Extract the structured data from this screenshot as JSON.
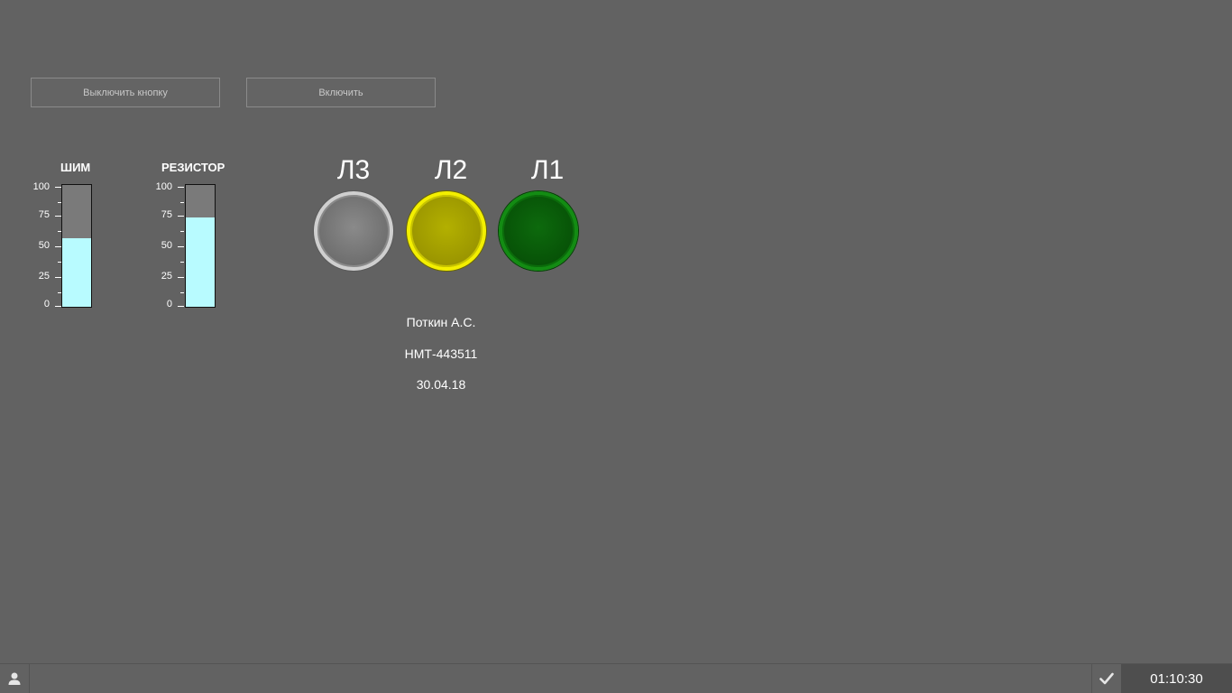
{
  "buttons": {
    "disable_label": "Выключить кнопку",
    "enable_label": "Включить"
  },
  "gauges": [
    {
      "title": "ШИМ",
      "value_percent": 56,
      "ticks": [
        "100",
        "75",
        "50",
        "25",
        "0"
      ]
    },
    {
      "title": "РЕЗИСТОР",
      "value_percent": 73,
      "ticks": [
        "100",
        "75",
        "50",
        "25",
        "0"
      ]
    }
  ],
  "lamps": [
    {
      "label": "Л3",
      "state": "off",
      "color": "#8a8a8a"
    },
    {
      "label": "Л2",
      "state": "on",
      "color": "#f3ef00"
    },
    {
      "label": "Л1",
      "state": "off",
      "color": "#138c13"
    }
  ],
  "info": {
    "name": "Поткин А.С.",
    "code": "НМТ-443511",
    "date": "30.04.18"
  },
  "statusbar": {
    "user_icon": "user-icon",
    "check_icon": "check-icon",
    "time": "01:10:30"
  },
  "colors": {
    "background": "#626262",
    "gauge_fill": "#b8fbff",
    "gauge_empty": "#7a7a7a"
  }
}
